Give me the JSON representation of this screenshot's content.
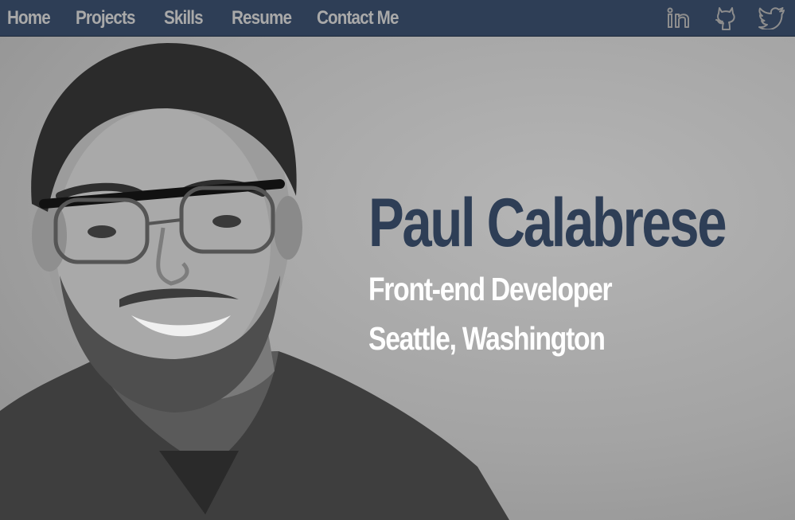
{
  "nav": {
    "links": [
      {
        "label": "Home"
      },
      {
        "label": "Projects"
      },
      {
        "label": "Skills"
      },
      {
        "label": "Resume"
      },
      {
        "label": "Contact Me"
      }
    ],
    "social": [
      {
        "icon": "linkedin-icon"
      },
      {
        "icon": "github-icon"
      },
      {
        "icon": "twitter-icon"
      }
    ]
  },
  "hero": {
    "name": "Paul Calabrese",
    "title": "Front-end Developer",
    "location": "Seattle, Washington"
  },
  "colors": {
    "navbar": "#2e3e56",
    "nav_text": "#a9a9a9",
    "name_text": "#2e3e56",
    "subtitle_text": "#ffffff",
    "background": "#a6a6a6"
  }
}
